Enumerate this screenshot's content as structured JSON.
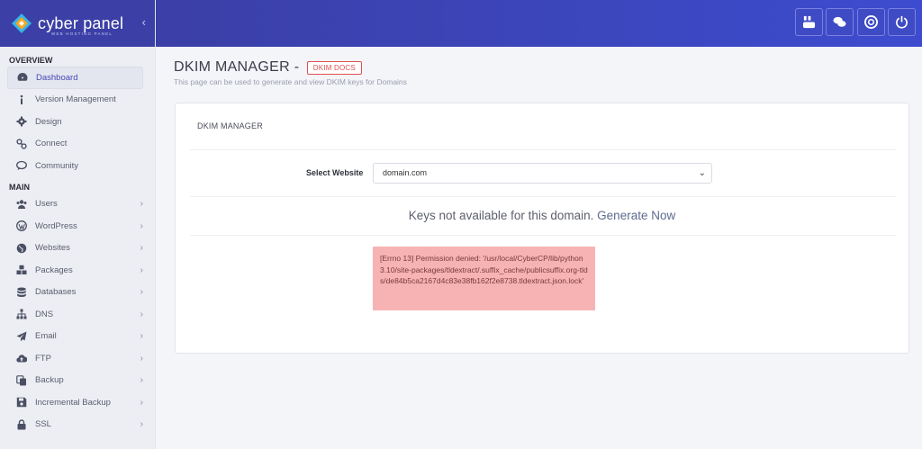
{
  "brand": {
    "name": "cyber panel",
    "tagline": "WEB HOSTING PANEL",
    "collapse_icon": "chevron-left-icon"
  },
  "sidebar": {
    "overview_title": "OVERVIEW",
    "overview_items": [
      {
        "label": "Dashboard",
        "icon": "dashboard-icon",
        "active": true
      },
      {
        "label": "Version Management",
        "icon": "info-icon"
      },
      {
        "label": "Design",
        "icon": "cog-icon"
      },
      {
        "label": "Connect",
        "icon": "link-icon"
      },
      {
        "label": "Community",
        "icon": "comments-icon"
      }
    ],
    "main_title": "MAIN",
    "main_items": [
      {
        "label": "Users",
        "icon": "users-icon"
      },
      {
        "label": "WordPress",
        "icon": "wordpress-icon"
      },
      {
        "label": "Websites",
        "icon": "globe-icon"
      },
      {
        "label": "Packages",
        "icon": "cubes-icon"
      },
      {
        "label": "Databases",
        "icon": "database-icon"
      },
      {
        "label": "DNS",
        "icon": "sitemap-icon"
      },
      {
        "label": "Email",
        "icon": "paper-plane-icon"
      },
      {
        "label": "FTP",
        "icon": "cloud-upload-icon"
      },
      {
        "label": "Backup",
        "icon": "copy-icon"
      },
      {
        "label": "Incremental Backup",
        "icon": "save-icon"
      },
      {
        "label": "SSL",
        "icon": "lock-icon"
      }
    ]
  },
  "topbar": {
    "buttons": [
      "youtube-icon",
      "chat-icon",
      "support-icon",
      "power-icon"
    ]
  },
  "page": {
    "title": "DKIM MANAGER -",
    "docs_badge": "DKIM DOCS",
    "subtitle": "This page can be used to generate and view DKIM keys for Domains"
  },
  "panel": {
    "title": "DKIM MANAGER",
    "select_label": "Select Website",
    "select_value": "domain.com",
    "keys_message": "Keys not available for this domain.",
    "generate_link": "Generate Now",
    "error_text": "[Errno 13] Permission denied: '/usr/local/CyberCP/lib/python3.10/site-packages/tldextract/.suffix_cache/publicsuffix.org-tlds/de84b5ca2167d4c83e38fb162f2e8738.tldextract.json.lock'"
  },
  "colors": {
    "brand": "#3b3fa6",
    "accent": "#3d4ccf",
    "error_bg": "#f7b3b3",
    "badge": "#e05050"
  }
}
